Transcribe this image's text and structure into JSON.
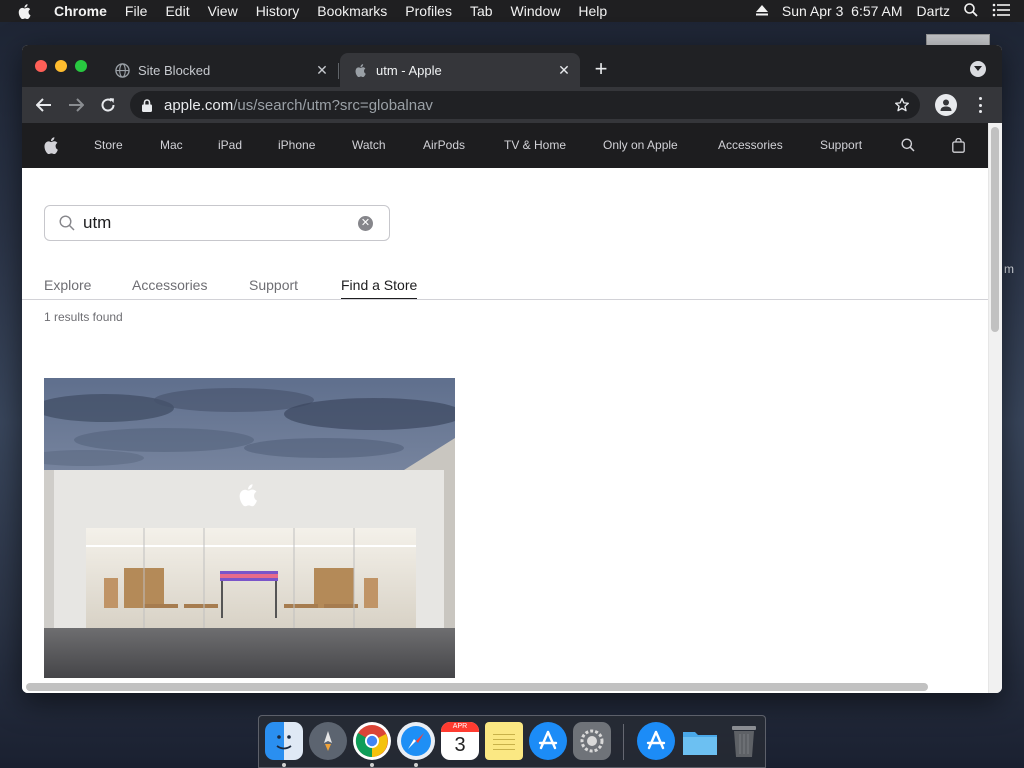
{
  "menubar": {
    "app_name": "Chrome",
    "menus": [
      "File",
      "Edit",
      "View",
      "History",
      "Bookmarks",
      "Profiles",
      "Tab",
      "Window",
      "Help"
    ],
    "datetime": "Sun Apr 3  6:57 AM",
    "user": "Dartz"
  },
  "desktop": {
    "edge_text": "m"
  },
  "browser": {
    "tabs": [
      {
        "title": "Site Blocked",
        "icon": "globe-icon",
        "active": false
      },
      {
        "title": "utm - Apple",
        "icon": "apple-logo-icon",
        "active": true
      }
    ],
    "address": {
      "domain": "apple.com",
      "path": "/us/search/utm?src=globalnav"
    }
  },
  "apple_nav": {
    "items": [
      "Store",
      "Mac",
      "iPad",
      "iPhone",
      "Watch",
      "AirPods",
      "TV & Home",
      "Only on Apple",
      "Accessories",
      "Support"
    ]
  },
  "search": {
    "query": "utm"
  },
  "result_tabs": {
    "items": [
      "Explore",
      "Accessories",
      "Support",
      "Find a Store"
    ],
    "active": "Find a Store"
  },
  "results": {
    "count_text": "1 results found"
  },
  "dock": {
    "calendar_month": "APR",
    "calendar_day": "3",
    "apps": [
      "finder-icon",
      "launchpad-icon",
      "chrome-icon",
      "safari-icon",
      "calendar-icon",
      "notes-icon",
      "app-store-icon",
      "system-preferences-icon",
      "app-store-download-icon",
      "folder-icon",
      "trash-icon"
    ]
  },
  "colors": {
    "apple_nav_bg": "#1d1d1f",
    "chrome_tabstrip": "#202124",
    "chrome_toolbar": "#35363a",
    "traffic_close": "#ff5f57",
    "traffic_min": "#febc2e",
    "traffic_max": "#28c840"
  }
}
